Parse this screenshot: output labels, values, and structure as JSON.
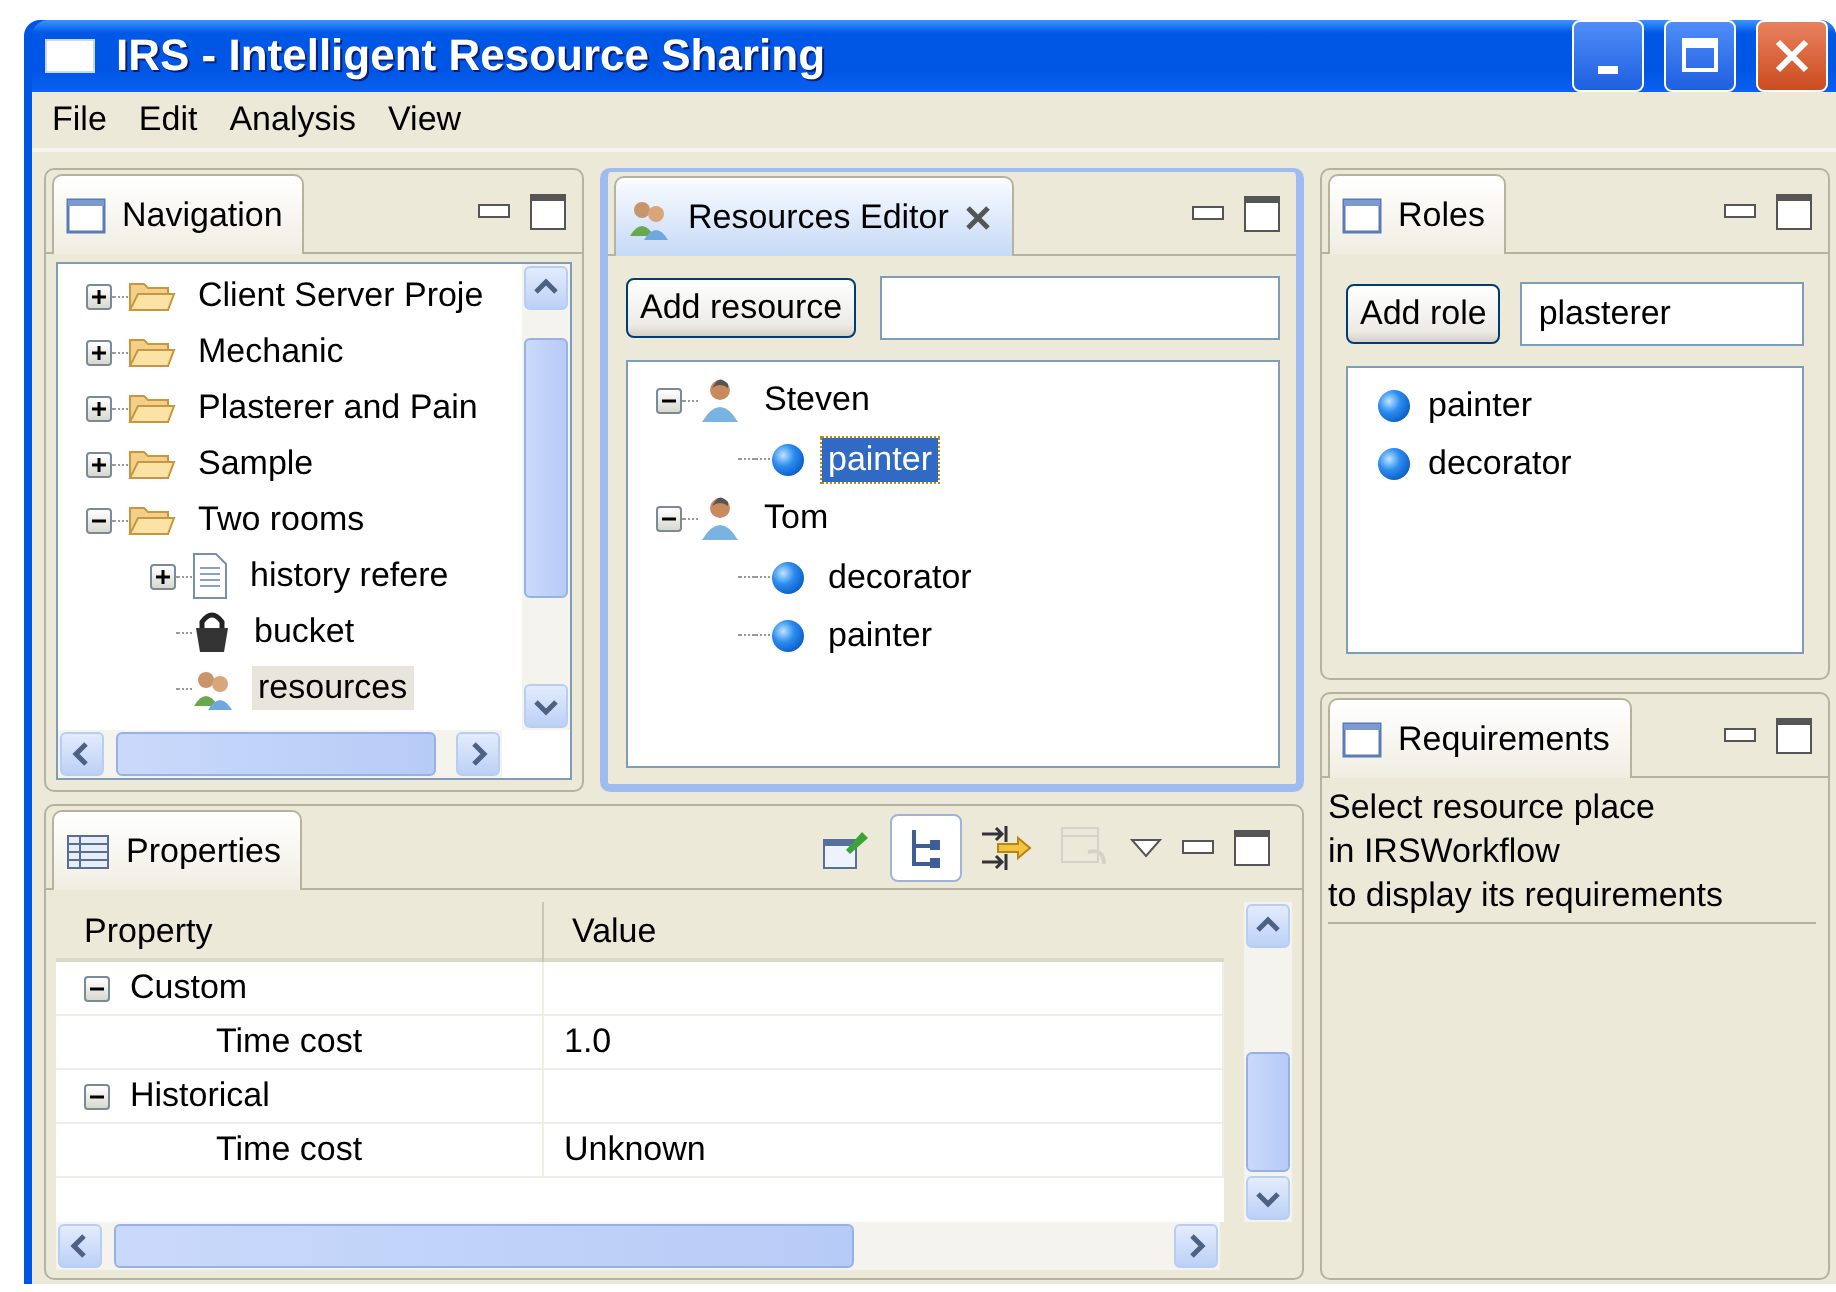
{
  "window": {
    "title": "IRS - Intelligent Resource Sharing"
  },
  "menu": [
    "File",
    "Edit",
    "Analysis",
    "View"
  ],
  "navigation": {
    "tab": "Navigation",
    "tree": [
      {
        "label": "Client Server Proje",
        "kind": "folder",
        "expanded": false,
        "selected": false
      },
      {
        "label": "Mechanic",
        "kind": "folder",
        "expanded": false,
        "selected": false
      },
      {
        "label": "Plasterer and Pain",
        "kind": "folder",
        "expanded": false,
        "selected": false
      },
      {
        "label": "Sample",
        "kind": "folder",
        "expanded": false,
        "selected": false
      },
      {
        "label": "Two rooms",
        "kind": "folder",
        "expanded": true,
        "selected": false,
        "children": [
          {
            "label": "history refere",
            "kind": "document",
            "expanded": false,
            "selected": false
          },
          {
            "label": "bucket",
            "kind": "padlock",
            "selected": false
          },
          {
            "label": "resources",
            "kind": "people",
            "selected": true
          }
        ]
      }
    ]
  },
  "resources_editor": {
    "tab": "Resources Editor",
    "add_button": "Add resource",
    "tree": [
      {
        "label": "Steven",
        "expanded": true,
        "children": [
          {
            "label": "painter",
            "selected": true
          }
        ]
      },
      {
        "label": "Tom",
        "expanded": true,
        "children": [
          {
            "label": "decorator",
            "selected": false
          },
          {
            "label": "painter",
            "selected": false
          }
        ]
      }
    ]
  },
  "roles": {
    "tab": "Roles",
    "add_button": "Add role",
    "field_value": "plasterer",
    "items": [
      {
        "label": "painter"
      },
      {
        "label": "decorator"
      }
    ]
  },
  "requirements": {
    "tab": "Requirements",
    "message": [
      "Select resource place",
      "in IRSWorkflow",
      "to display its requirements"
    ]
  },
  "properties": {
    "tab": "Properties",
    "toolbar": [
      {
        "kind": "pin",
        "selected": false,
        "disabled": false
      },
      {
        "kind": "categories",
        "selected": true,
        "disabled": false
      },
      {
        "kind": "advanced",
        "selected": false,
        "disabled": false
      },
      {
        "kind": "defaults",
        "selected": false,
        "disabled": true
      }
    ],
    "columns": [
      "Property",
      "Value"
    ],
    "rows": [
      {
        "kind": "category",
        "property": "Custom",
        "expanded": true
      },
      {
        "kind": "property",
        "property": "Time cost",
        "value": "1.0"
      },
      {
        "kind": "category",
        "property": "Historical",
        "expanded": true
      },
      {
        "kind": "property",
        "property": "Time cost",
        "value": "Unknown"
      }
    ]
  }
}
